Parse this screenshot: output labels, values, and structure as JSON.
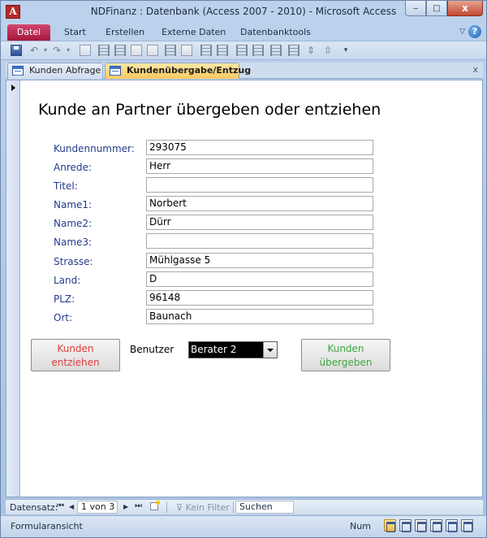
{
  "window": {
    "title": "NDFinanz : Datenbank (Access 2007 - 2010)  -  Microsoft Access",
    "app_icon_letter": "A",
    "minimize": "‒",
    "maximize": "□",
    "close": "x"
  },
  "ribbon": {
    "file_tab": "Datei",
    "tabs": [
      "Start",
      "Erstellen",
      "Externe Daten",
      "Datenbanktools"
    ],
    "help": "?",
    "collapse": "▽"
  },
  "quick_access": {
    "icons": [
      "save-icon",
      "undo-icon",
      "redo-icon",
      "toolbar-icons"
    ]
  },
  "doc_tabs": {
    "tabs": [
      {
        "label": "Kunden Abfrage",
        "active": false
      },
      {
        "label": "Kundenübergabe/Entzug",
        "active": true
      }
    ],
    "close": "x"
  },
  "form": {
    "heading": "Kunde an Partner übergeben oder entziehen",
    "fields": [
      {
        "label": "Kundennummer:",
        "value": "293075"
      },
      {
        "label": "Anrede:",
        "value": "Herr"
      },
      {
        "label": "Titel:",
        "value": ""
      },
      {
        "label": "Name1:",
        "value": "Norbert"
      },
      {
        "label": "Name2:",
        "value": "Dürr"
      },
      {
        "label": "Name3:",
        "value": ""
      },
      {
        "label": "Strasse:",
        "value": "Mühlgasse 5"
      },
      {
        "label": "Land:",
        "value": "D"
      },
      {
        "label": "PLZ:",
        "value": "96148"
      },
      {
        "label": "Ort:",
        "value": "Baunach"
      }
    ],
    "remove_button": {
      "line1": "Kunden",
      "line2": "entziehen",
      "color": "#e03b3b"
    },
    "transfer_button": {
      "line1": "Kunden",
      "line2": "übergeben",
      "color": "#3ca83c"
    },
    "user_label": "Benutzer",
    "user_value": "Berater 2"
  },
  "navigation": {
    "label": "Datensatz:",
    "record": "1 von 3",
    "first": "⏮",
    "prev": "◀",
    "next": "▶",
    "last": "⏭",
    "filter": "Kein Filter",
    "search": "Suchen"
  },
  "status": {
    "view": "Formularansicht",
    "num": "Num"
  },
  "colors": {
    "label_text": "#24398c",
    "active_tab": "#f8c960",
    "file_tab": "#a5183c"
  }
}
